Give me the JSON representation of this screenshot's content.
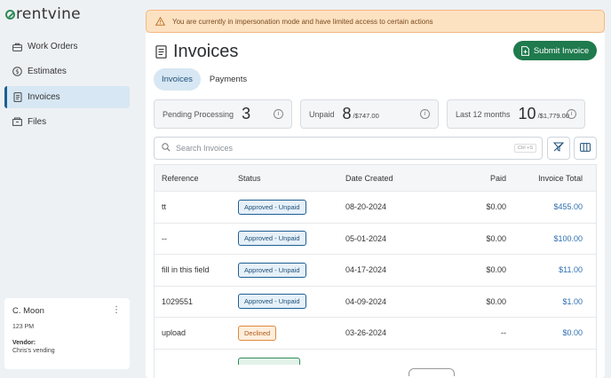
{
  "brand": {
    "logo_text": "rentvine",
    "accent": "#2e8b57"
  },
  "sidebar": {
    "items": [
      {
        "label": "Work Orders",
        "icon": "briefcase-icon",
        "active": false
      },
      {
        "label": "Estimates",
        "icon": "dollar-circle-icon",
        "active": false
      },
      {
        "label": "Invoices",
        "icon": "receipt-icon",
        "active": true
      },
      {
        "label": "Files",
        "icon": "folder-icon",
        "active": false
      }
    ],
    "user": {
      "name": "C. Moon",
      "time": "123 PM",
      "vendor_label": "Vendor:",
      "vendor": "Chris's vending"
    }
  },
  "banner": {
    "text": "You are currently in impersonation mode and have limited access to certain actions",
    "color": "#fde2c2"
  },
  "header": {
    "title": "Invoices",
    "submit_label": "Submit Invoice",
    "submit_color": "#1f7a4d"
  },
  "tabs": [
    {
      "label": "Invoices",
      "active": true
    },
    {
      "label": "Payments",
      "active": false
    }
  ],
  "stats": [
    {
      "label": "Pending Processing",
      "value": "3",
      "sub": ""
    },
    {
      "label": "Unpaid",
      "value": "8",
      "sub": "/$747.00"
    },
    {
      "label": "Last 12 months",
      "value": "10",
      "sub": "/$1,779.00"
    }
  ],
  "search": {
    "placeholder": "Search Invoices",
    "shortcut": "Ctrl +S"
  },
  "table": {
    "columns": {
      "reference": "Reference",
      "status": "Status",
      "date": "Date Created",
      "paid": "Paid",
      "total": "Invoice Total"
    },
    "rows": [
      {
        "reference": "tt",
        "status": "Approved - Unpaid",
        "status_type": "approved",
        "date": "08-20-2024",
        "paid": "$0.00",
        "total": "$455.00"
      },
      {
        "reference": "--",
        "status": "Approved - Unpaid",
        "status_type": "approved",
        "date": "05-01-2024",
        "paid": "$0.00",
        "total": "$100.00"
      },
      {
        "reference": "fill in this field",
        "status": "Approved - Unpaid",
        "status_type": "approved",
        "date": "04-17-2024",
        "paid": "$0.00",
        "total": "$11.00"
      },
      {
        "reference": "1029551",
        "status": "Approved - Unpaid",
        "status_type": "approved",
        "date": "04-09-2024",
        "paid": "$0.00",
        "total": "$1.00"
      },
      {
        "reference": "upload",
        "status": "Declined",
        "status_type": "declined",
        "date": "03-26-2024",
        "paid": "--",
        "total": "$0.00"
      }
    ]
  }
}
